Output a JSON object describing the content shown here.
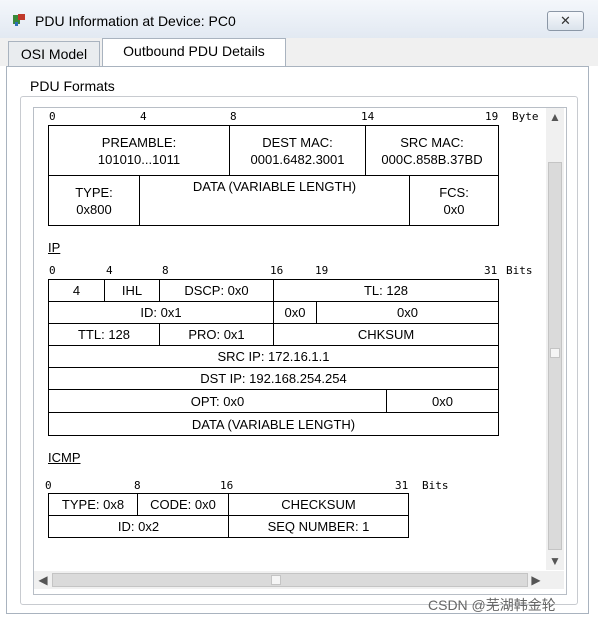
{
  "window": {
    "title": "PDU Information at Device: PC0",
    "close_label": "✕"
  },
  "tabs": [
    {
      "label": "OSI Model"
    },
    {
      "label": "Outbound PDU Details"
    }
  ],
  "group_label": "PDU Formats",
  "ethernet": {
    "ruler": {
      "t0": "0",
      "t4": "4",
      "t8": "8",
      "t14": "14",
      "t19": "19",
      "unit": "Byte"
    },
    "preamble": "PREAMBLE:\n101010...1011",
    "dest_mac": "DEST MAC:\n0001.6482.3001",
    "src_mac": "SRC MAC:\n000C.858B.37BD",
    "type": "TYPE:\n0x800",
    "data": "DATA (VARIABLE LENGTH)",
    "fcs": "FCS:\n0x0"
  },
  "ip": {
    "heading": "IP",
    "ruler": {
      "t0": "0",
      "t4": "4",
      "t8": "8",
      "t16": "16",
      "t19": "19",
      "t31": "31",
      "unit": "Bits"
    },
    "version": "4",
    "ihl": "IHL",
    "dscp": "DSCP: 0x0",
    "tl": "TL: 128",
    "id": "ID: 0x1",
    "flags": "0x0",
    "frag": "0x0",
    "ttl": "TTL: 128",
    "pro": "PRO: 0x1",
    "chksum": "CHKSUM",
    "src_ip": "SRC IP: 172.16.1.1",
    "dst_ip": "DST IP: 192.168.254.254",
    "opt": "OPT: 0x0",
    "opt_pad": "0x0",
    "data": "DATA (VARIABLE LENGTH)"
  },
  "icmp": {
    "heading": "ICMP",
    "ruler": {
      "t0": "0",
      "t8": "8",
      "t16": "16",
      "t31": "31",
      "unit": "Bits"
    },
    "type": "TYPE: 0x8",
    "code": "CODE: 0x0",
    "checksum": "CHECKSUM",
    "id": "ID: 0x2",
    "seq": "SEQ NUMBER: 1"
  },
  "scroll": {
    "up": "▲",
    "down": "▼",
    "left": "◀",
    "right": "▶"
  },
  "watermark": "CSDN @芜湖韩金轮"
}
